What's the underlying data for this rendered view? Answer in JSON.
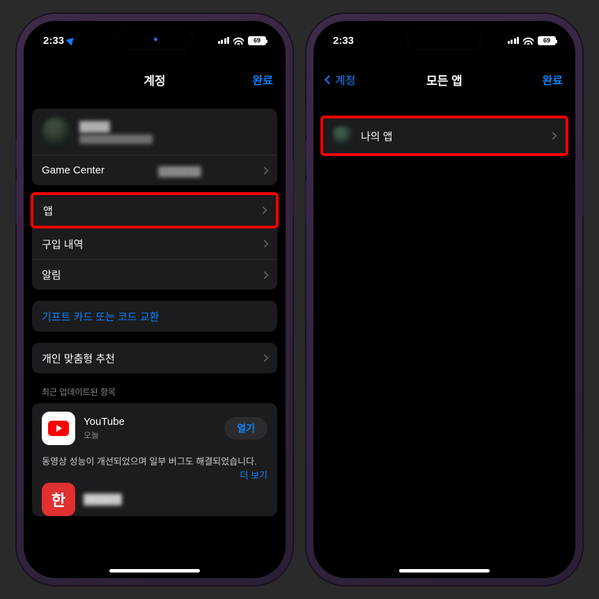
{
  "status": {
    "time": "2:33",
    "battery": "69"
  },
  "left_screen": {
    "title": "계정",
    "done": "완료",
    "profile": {
      "name": "▓▓▓▓",
      "subtitle": "▓▓▓▓▓▓▓▓▓▓▓▓"
    },
    "game_center": {
      "label": "Game Center",
      "value": "▓▓▓▓▓▓"
    },
    "rows": {
      "apps": "앱",
      "purchases": "구입 내역",
      "notifications": "알림"
    },
    "redeem": "기프트 카드 또는 코드 교환",
    "personalized": "개인 맞춤형 추천",
    "recent_header": "최근 업데이트된 항목",
    "youtube": {
      "name": "YouTube",
      "date": "오늘",
      "open": "열기"
    },
    "desc_text": "동영상 성능이 개선되었으며 일부 버그도 해결되었습니다.",
    "more": "더 보기",
    "partial_app": {
      "badge": "한",
      "name": "▓▓▓▓▓"
    }
  },
  "right_screen": {
    "back": "계정",
    "title": "모든 앱",
    "done": "완료",
    "my_apps": "나의 앱"
  }
}
